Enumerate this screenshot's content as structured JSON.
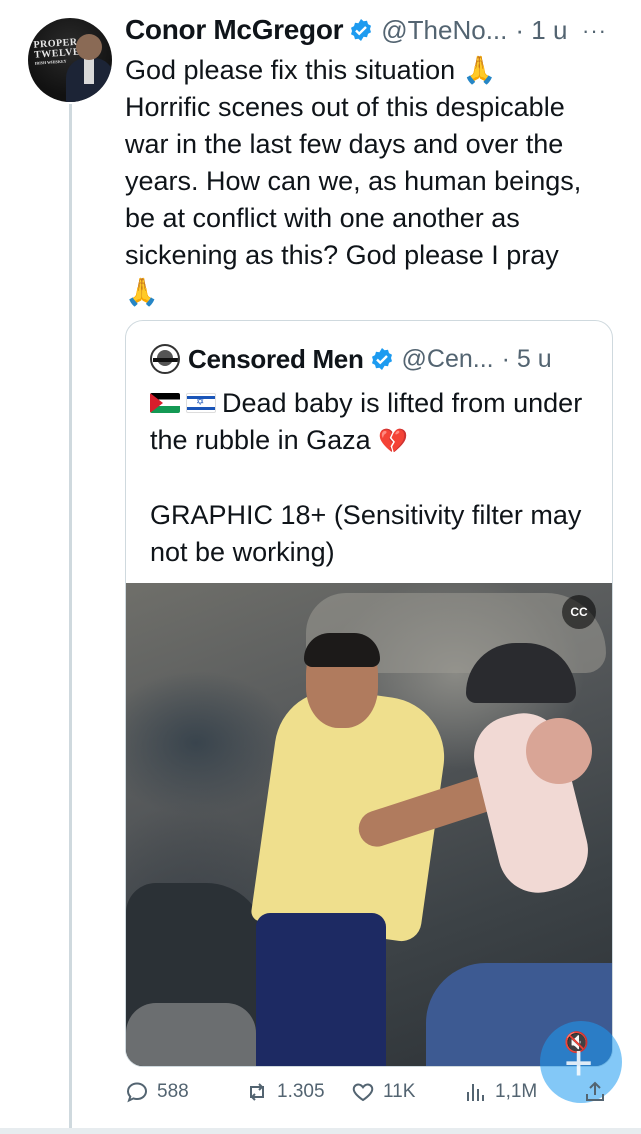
{
  "tweet": {
    "author_name": "Conor McGregor",
    "author_handle": "@TheNo...",
    "time": "· 1 u",
    "avatar_logo": "PROPER TWELVE",
    "avatar_logo_sub": "IRISH WHISKEY",
    "text": "God please fix this situation 🙏\nHorrific scenes out of this despicable war in the last few days and over the years. How can we, as human beings, be at conflict with one another as sickening as this? God please I pray\n🙏"
  },
  "quoted": {
    "author_name": "Censored Men",
    "author_handle": "@Cen...",
    "time": "· 5 u",
    "text_line1": "Dead baby is lifted from under the rubble in Gaza",
    "text_line2": "GRAPHIC 18+ (Sensitivity filter may not be working)",
    "heart_emoji": "💔",
    "flags": [
      "palestine-flag-icon",
      "israel-flag-icon"
    ]
  },
  "video": {
    "cc_label": "CC"
  },
  "actions": {
    "replies": "588",
    "reposts": "1.305",
    "likes": "11K",
    "views": "1,1M"
  },
  "colors": {
    "accent": "#1d9bf0",
    "secondary_text": "#536471",
    "border": "#cfd9de"
  }
}
